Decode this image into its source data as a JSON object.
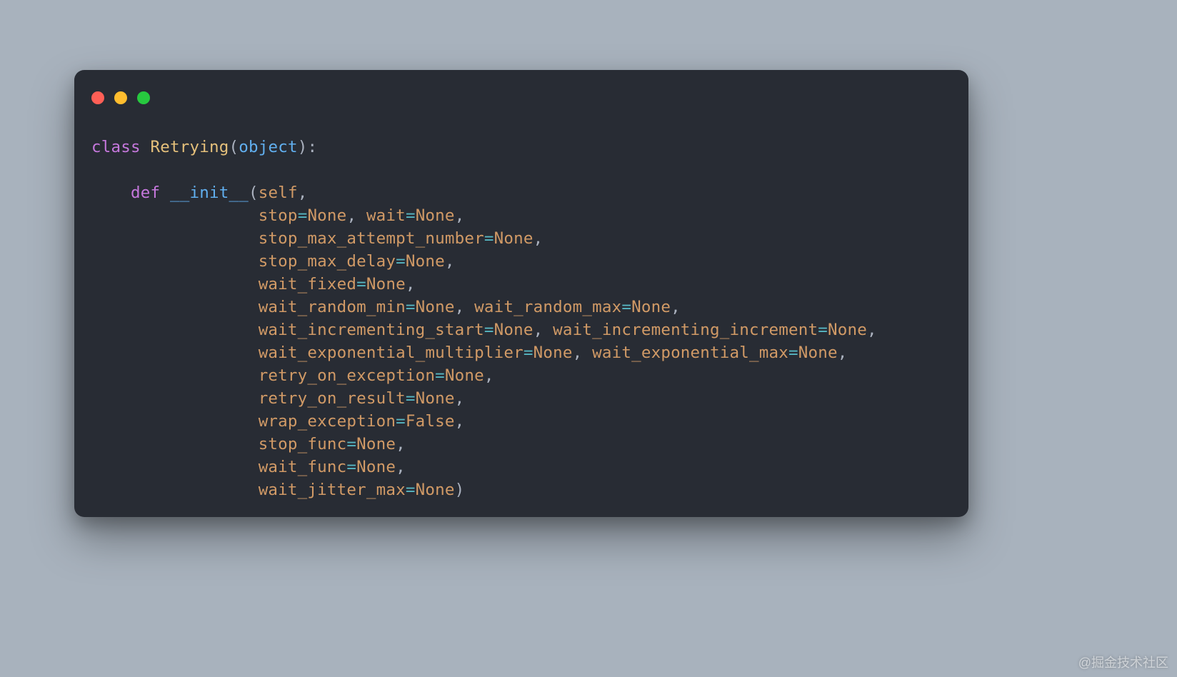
{
  "colors": {
    "page_bg": "#a8b2bd",
    "frame_bg": "#282c34",
    "keyword": "#c678dd",
    "classname": "#e5c07b",
    "type_fn": "#61afef",
    "param": "#d19a66",
    "operator": "#56b6c2",
    "constant": "#d19a66",
    "punct": "#abb2bf",
    "traffic_red": "#ff5f56",
    "traffic_yellow": "#ffbd2e",
    "traffic_green": "#27c93f"
  },
  "code": {
    "kw_class": "class",
    "cls_name": "Retrying",
    "base": "object",
    "kw_def": "def",
    "fn_name": "__init__",
    "self": "self",
    "params": {
      "stop": "stop",
      "wait": "wait",
      "stop_max_attempt_number": "stop_max_attempt_number",
      "stop_max_delay": "stop_max_delay",
      "wait_fixed": "wait_fixed",
      "wait_random_min": "wait_random_min",
      "wait_random_max": "wait_random_max",
      "wait_incrementing_start": "wait_incrementing_start",
      "wait_incrementing_increment": "wait_incrementing_increment",
      "wait_exponential_multiplier": "wait_exponential_multiplier",
      "wait_exponential_max": "wait_exponential_max",
      "retry_on_exception": "retry_on_exception",
      "retry_on_result": "retry_on_result",
      "wrap_exception": "wrap_exception",
      "stop_func": "stop_func",
      "wait_func": "wait_func",
      "wait_jitter_max": "wait_jitter_max"
    },
    "const_none": "None",
    "const_false": "False",
    "eq": "=",
    "lparen": "(",
    "rparen": ")",
    "comma": ",",
    "colon": ":"
  },
  "watermark": "@掘金技术社区"
}
